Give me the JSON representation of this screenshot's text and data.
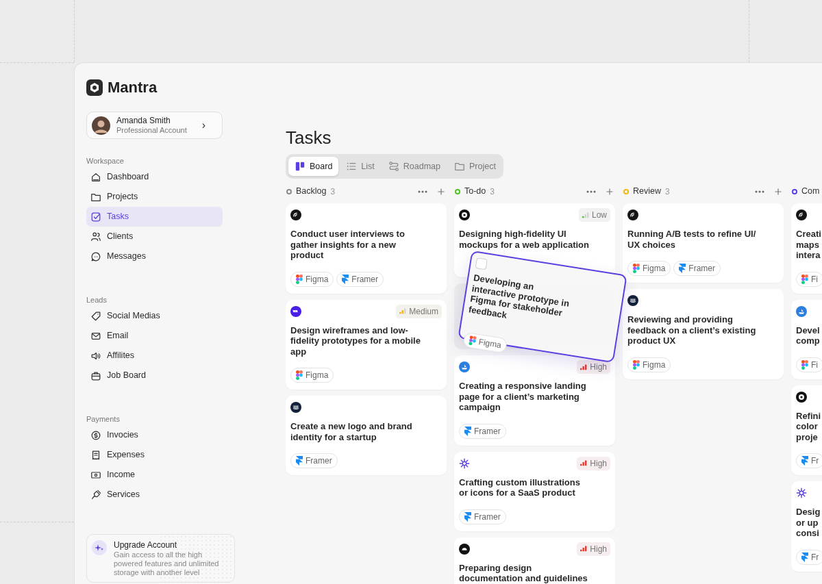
{
  "app": {
    "name": "Mantra"
  },
  "profile": {
    "name": "Amanda Smith",
    "subtitle": "Professional Account",
    "chevron": "›"
  },
  "sidebar": {
    "sections": [
      {
        "title": "Workspace",
        "items": [
          {
            "label": "Dashboard",
            "selected": false
          },
          {
            "label": "Projects",
            "selected": false
          },
          {
            "label": "Tasks",
            "selected": true
          },
          {
            "label": "Clients",
            "selected": false
          },
          {
            "label": "Messages",
            "selected": false
          }
        ]
      },
      {
        "title": "Leads",
        "items": [
          {
            "label": "Social Medias",
            "selected": false
          },
          {
            "label": "Email",
            "selected": false
          },
          {
            "label": "Affilites",
            "selected": false
          },
          {
            "label": "Job Board",
            "selected": false
          }
        ]
      },
      {
        "title": "Payments",
        "items": [
          {
            "label": "Invocies",
            "selected": false
          },
          {
            "label": "Expenses",
            "selected": false
          },
          {
            "label": "Income",
            "selected": false
          },
          {
            "label": "Services",
            "selected": false
          }
        ]
      }
    ]
  },
  "upgrade": {
    "title": "Upgrade Account",
    "text": "Gain access to all the high powered features and unlimited storage with another level"
  },
  "page": {
    "title": "Tasks"
  },
  "views": [
    {
      "label": "Board",
      "selected": true
    },
    {
      "label": "List",
      "selected": false
    },
    {
      "label": "Roadmap",
      "selected": false
    },
    {
      "label": "Project",
      "selected": false
    }
  ],
  "columns": [
    {
      "title": "Backlog",
      "count": "3",
      "color": "#8a8a8a",
      "cards": [
        {
          "kind": "task",
          "title": "Conduct user interviews to gather insights for a new product",
          "tags": [
            {
              "kind": "figma",
              "label": "Figma"
            },
            {
              "kind": "framer",
              "label": "Framer"
            }
          ]
        },
        {
          "kind": "task",
          "priority": {
            "kind": "medium",
            "label": "Medium"
          },
          "title": "Design wireframes and low-fidelity prototypes for a mobile app",
          "tags": [
            {
              "kind": "figma",
              "label": "Figma"
            }
          ]
        },
        {
          "kind": "task",
          "title": "Create a new logo and brand identity for a startup",
          "tags": [
            {
              "kind": "framer",
              "label": "Framer"
            }
          ]
        }
      ]
    },
    {
      "title": "To-do",
      "count": "3",
      "color": "#4fc226",
      "cards": [
        {
          "kind": "task",
          "priority": {
            "kind": "low",
            "label": "Low"
          },
          "title": "Designing high-fidelity UI mockups for a web application"
        },
        {
          "kind": "slot"
        },
        {
          "kind": "task",
          "priority": {
            "kind": "high",
            "label": "High"
          },
          "title": "Creating a responsive landing page for a client’s marketing campaign",
          "tags": [
            {
              "kind": "framer",
              "label": "Framer"
            }
          ]
        },
        {
          "kind": "task",
          "priority": {
            "kind": "high",
            "label": "High"
          },
          "title": "Crafting custom illustrations or icons for a SaaS product",
          "tags": [
            {
              "kind": "framer",
              "label": "Framer"
            }
          ]
        },
        {
          "kind": "task",
          "priority": {
            "kind": "high",
            "label": "High"
          },
          "title": "Preparing design documentation and guidelines"
        }
      ]
    },
    {
      "title": "Review",
      "count": "3",
      "color": "#f5b40f",
      "cards": [
        {
          "kind": "task",
          "title": "Running A/B tests to refine UI/ UX choices",
          "tags": [
            {
              "kind": "figma",
              "label": "Figma"
            },
            {
              "kind": "framer",
              "label": "Framer"
            }
          ]
        },
        {
          "kind": "task",
          "title": "Reviewing and providing feedback on a client’s existing product UX",
          "tags": [
            {
              "kind": "figma",
              "label": "Figma"
            }
          ]
        }
      ]
    },
    {
      "title": "Com",
      "color": "#5b3fe0",
      "cards": [
        {
          "kind": "task",
          "title": "Creati\nmaps\nintera",
          "tags": [
            {
              "kind": "figma",
              "label": "Fi"
            }
          ]
        },
        {
          "kind": "task",
          "title": "Devel\ncomp",
          "tags": [
            {
              "kind": "figma",
              "label": "Fi"
            }
          ]
        },
        {
          "kind": "task",
          "title": "Refini\ncolor\nproje",
          "tags": [
            {
              "kind": "framer",
              "label": "Fr"
            }
          ]
        },
        {
          "kind": "task",
          "title": "Desig\nor up\nconsi",
          "tags": [
            {
              "kind": "framer",
              "label": "Fr"
            }
          ]
        }
      ]
    }
  ],
  "dragging": {
    "checked": false,
    "title": "Developing an interactive prototype in Figma for stakeholder feedback",
    "tags": [
      {
        "kind": "figma",
        "label": "Figma"
      }
    ]
  }
}
